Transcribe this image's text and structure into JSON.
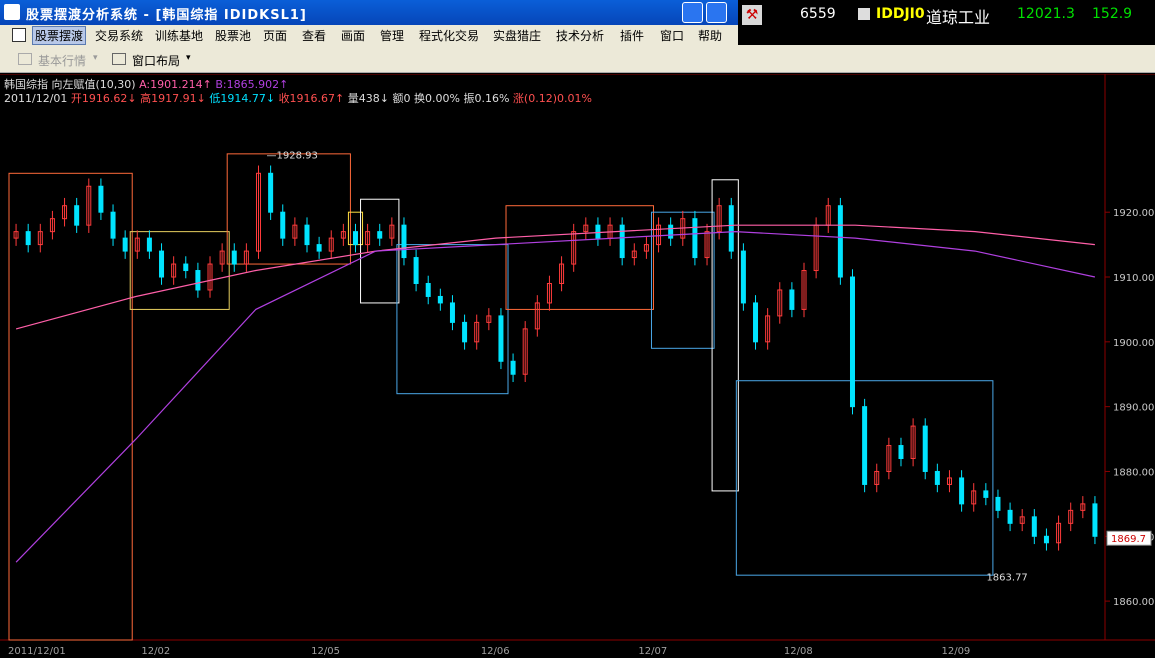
{
  "window": {
    "title": "股票摆渡分析系统 - [韩国综指 IDIDKSL1]"
  },
  "quote_panel": {
    "icon": "hammer-icon",
    "number": "6559",
    "code": "IDDJI0",
    "name": "道琼工业",
    "price": "12021.3",
    "change": "152.9"
  },
  "menu": {
    "items": [
      "股票摆渡",
      "交易系统",
      "训练基地",
      "股票池",
      "页面",
      "查看",
      "画面",
      "管理",
      "程式化交易",
      "实盘猎庄",
      "技术分析",
      "插件",
      "窗口",
      "帮助"
    ],
    "active": "股票摆渡"
  },
  "toolbar": {
    "basic_quote": "基本行情",
    "window_layout": "窗口布局"
  },
  "info": {
    "name": "韩国综指",
    "label": "向左赋值(10,30)",
    "a_text": "A:1901.214↑",
    "b_text": "B:1865.902↑",
    "date": "2011/12/01",
    "open": "开1916.62↓",
    "high": "高1917.91↓",
    "low": "低1914.77↓",
    "close": "收1916.67↑",
    "vol": "量438↓",
    "amount": "额0",
    "turnover": "换0.00%",
    "amplitude": "振0.16%",
    "rise": "涨(0.12)0.01%"
  },
  "colors": {
    "up": "#ff3b3b",
    "down": "#00e4ff",
    "ma_fast": "#ff5fa8",
    "ma_slow": "#b040e0",
    "grid": "#8b0000",
    "axis_text": "#c8c8c8"
  },
  "chart_data": {
    "type": "candlestick",
    "title": "韩国综指",
    "y_ticks": [
      1860,
      1870,
      1880,
      1890,
      1900,
      1910,
      1920
    ],
    "y_tick_labels": [
      "1860.00",
      "1870.00",
      "1880.00",
      "1890.00",
      "1900.00",
      "1910.00",
      "1920.00"
    ],
    "ylim": [
      1854,
      1937
    ],
    "x_tick_labels": [
      "2011/12/01",
      "12/02",
      "12/05",
      "12/06",
      "12/07",
      "12/08",
      "12/09"
    ],
    "current_price_label": "1869.7",
    "high_annotation": "1928.93",
    "low_annotation": "1863.77",
    "series": [
      {
        "name": "OHLC",
        "close": [
          1917,
          1915,
          1917,
          1919,
          1921,
          1918,
          1924,
          1920,
          1916,
          1914,
          1916,
          1914,
          1910,
          1912,
          1911,
          1908,
          1912,
          1914,
          1912,
          1914,
          1926,
          1920,
          1916,
          1918,
          1915,
          1914,
          1916,
          1917,
          1915,
          1917,
          1916,
          1918,
          1913,
          1909,
          1907,
          1906,
          1903,
          1900,
          1903,
          1904,
          1897,
          1895,
          1902,
          1906,
          1909,
          1912,
          1917,
          1918,
          1916,
          1918,
          1913,
          1914,
          1915,
          1918,
          1916,
          1919,
          1913,
          1917,
          1921,
          1914,
          1906,
          1900,
          1904,
          1908,
          1905,
          1911,
          1918,
          1921,
          1910,
          1890,
          1878,
          1880,
          1884,
          1882,
          1887,
          1880,
          1878,
          1879,
          1875,
          1877,
          1876,
          1874,
          1872,
          1873,
          1870,
          1869,
          1872,
          1874,
          1875,
          1870
        ]
      },
      {
        "name": "MA10",
        "values": [
          1902,
          1907,
          1911,
          1914,
          1916,
          1917,
          1918,
          1918,
          1917,
          1915
        ]
      },
      {
        "name": "MA30",
        "values": [
          1866,
          1885,
          1905,
          1914,
          1915,
          1916,
          1917,
          1916,
          1914,
          1910
        ]
      }
    ],
    "boxes": [
      {
        "color": "#ff6a3a",
        "from": 0,
        "to": 9,
        "high": 1926,
        "low": 1854
      },
      {
        "color": "#e8d060",
        "from": 10,
        "to": 17,
        "high": 1917,
        "low": 1905
      },
      {
        "color": "#ff6a3a",
        "from": 18,
        "to": 27,
        "high": 1929,
        "low": 1912
      },
      {
        "color": "#ffe040",
        "from": 28,
        "to": 28,
        "high": 1920,
        "low": 1915
      },
      {
        "color": "#ffffff",
        "from": 29,
        "to": 31,
        "high": 1922,
        "low": 1906
      },
      {
        "color": "#4aa8e8",
        "from": 32,
        "to": 40,
        "high": 1915,
        "low": 1892
      },
      {
        "color": "#ff6a3a",
        "from": 41,
        "to": 52,
        "high": 1921,
        "low": 1905
      },
      {
        "color": "#4aa8e8",
        "from": 53,
        "to": 57,
        "high": 1920,
        "low": 1899
      },
      {
        "color": "#ffffff",
        "from": 58,
        "to": 59,
        "high": 1925,
        "low": 1877
      },
      {
        "color": "#4aa8e8",
        "from": 60,
        "to": 80,
        "high": 1894,
        "low": 1864
      }
    ]
  }
}
